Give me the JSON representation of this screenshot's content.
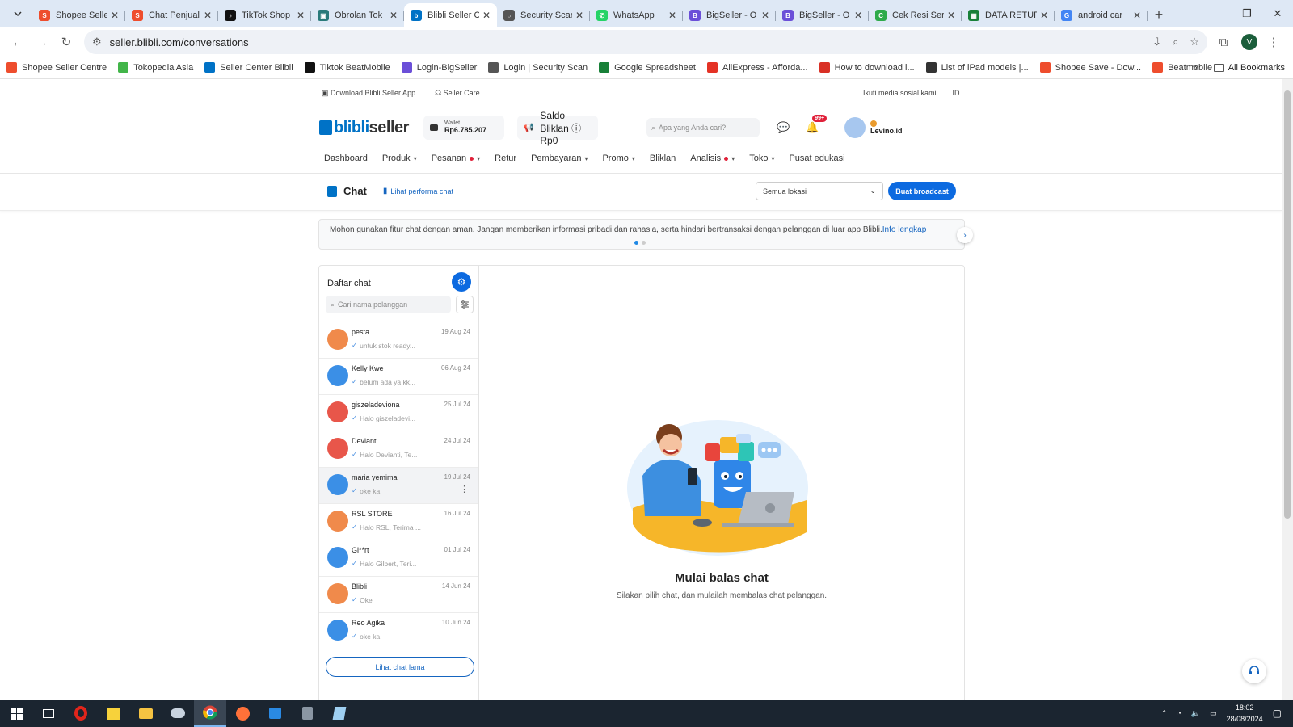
{
  "browser": {
    "tabs": [
      {
        "title": "Shopee Seller",
        "color": "#ee4d2d",
        "glyph": "S",
        "active": false
      },
      {
        "title": "Chat Penjual",
        "color": "#ee4d2d",
        "glyph": "S",
        "active": false
      },
      {
        "title": "TikTok Shop",
        "color": "#111111",
        "glyph": "♪",
        "active": false
      },
      {
        "title": "Obrolan Tok",
        "color": "#2a7a7a",
        "glyph": "▣",
        "active": false
      },
      {
        "title": "Blibli Seller C",
        "color": "#0072c6",
        "glyph": "b",
        "active": true
      },
      {
        "title": "Security Scan",
        "color": "#555555",
        "glyph": "○",
        "active": false
      },
      {
        "title": "WhatsApp",
        "color": "#25d366",
        "glyph": "✆",
        "active": false
      },
      {
        "title": "BigSeller - O",
        "color": "#6b4fd8",
        "glyph": "B",
        "active": false
      },
      {
        "title": "BigSeller - O",
        "color": "#6b4fd8",
        "glyph": "B",
        "active": false
      },
      {
        "title": "Cek Resi Ser",
        "color": "#2eaa4a",
        "glyph": "C",
        "active": false
      },
      {
        "title": "DATA RETUR",
        "color": "#188038",
        "glyph": "▦",
        "active": false
      },
      {
        "title": "android car",
        "color": "#4285f4",
        "glyph": "G",
        "active": false
      }
    ],
    "url": "seller.blibli.com/conversations",
    "profile_initial": "V",
    "bookmarks": [
      {
        "label": "Shopee Seller Centre",
        "color": "#ee4d2d"
      },
      {
        "label": "Tokopedia Asia",
        "color": "#42b549"
      },
      {
        "label": "Seller Center Blibli",
        "color": "#0072c6"
      },
      {
        "label": "Tiktok BeatMobile",
        "color": "#111111"
      },
      {
        "label": "Login-BigSeller",
        "color": "#6b4fd8"
      },
      {
        "label": "Login | Security Scan",
        "color": "#555555"
      },
      {
        "label": "Google Spreadsheet",
        "color": "#188038"
      },
      {
        "label": "AliExpress - Afforda...",
        "color": "#e43225"
      },
      {
        "label": "How to download i...",
        "color": "#d93025"
      },
      {
        "label": "List of iPad models |...",
        "color": "#333333"
      },
      {
        "label": "Shopee Save - Dow...",
        "color": "#ee4d2d"
      },
      {
        "label": "Beatmobile",
        "color": "#ee4d2d"
      }
    ],
    "all_bookmarks": "All Bookmarks"
  },
  "topbar": {
    "download_app": "Download Blibli Seller App",
    "seller_care": "Seller Care",
    "social": "Ikuti media sosial kami",
    "lang": "ID"
  },
  "header": {
    "logo_blibli": "blibli",
    "logo_seller": "seller",
    "wallet_label": "Wallet",
    "wallet_value": "Rp6.785.207",
    "saldo_label": "Saldo Bliklan",
    "saldo_value": "Rp0",
    "search_placeholder": "Apa yang Anda cari?",
    "notif_badge": "99+",
    "username": "Levino.id"
  },
  "nav": [
    {
      "label": "Dashboard",
      "chev": false,
      "dot": false
    },
    {
      "label": "Produk",
      "chev": true,
      "dot": false
    },
    {
      "label": "Pesanan",
      "chev": true,
      "dot": true
    },
    {
      "label": "Retur",
      "chev": false,
      "dot": false
    },
    {
      "label": "Pembayaran",
      "chev": true,
      "dot": false
    },
    {
      "label": "Promo",
      "chev": true,
      "dot": false
    },
    {
      "label": "Bliklan",
      "chev": false,
      "dot": false
    },
    {
      "label": "Analisis",
      "chev": true,
      "dot": true
    },
    {
      "label": "Toko",
      "chev": true,
      "dot": false
    },
    {
      "label": "Pusat edukasi",
      "chev": false,
      "dot": false
    }
  ],
  "chatbar": {
    "title": "Chat",
    "performance": "Lihat performa chat",
    "location": "Semua lokasi",
    "broadcast": "Buat broadcast"
  },
  "notice": {
    "text": "Mohon gunakan fitur chat dengan aman. Jangan memberikan informasi pribadi dan rahasia, serta hindari bertransaksi dengan pelanggan di luar app Blibli.",
    "link": "Info lengkap"
  },
  "chat_list": {
    "title": "Daftar chat",
    "search_placeholder": "Cari nama pelanggan",
    "items": [
      {
        "name": "pesta",
        "date": "19 Aug 24",
        "preview": "untuk stok ready...",
        "avatar": "#f08a4b",
        "selected": false
      },
      {
        "name": "Kelly Kwe",
        "date": "06 Aug 24",
        "preview": "belum ada ya kk...",
        "avatar": "#3b8fe6",
        "selected": false
      },
      {
        "name": "giszeladeviona",
        "date": "25 Jul 24",
        "preview": "Halo giszeladevi...",
        "avatar": "#e8564a",
        "selected": false
      },
      {
        "name": "Devianti",
        "date": "24 Jul 24",
        "preview": "Halo Devianti, Te...",
        "avatar": "#e8564a",
        "selected": false
      },
      {
        "name": "maria yemima",
        "date": "19 Jul 24",
        "preview": "oke ka",
        "avatar": "#3b8fe6",
        "selected": true
      },
      {
        "name": "RSL STORE",
        "date": "16 Jul 24",
        "preview": "Halo RSL, Terima ...",
        "avatar": "#f08a4b",
        "selected": false
      },
      {
        "name": "Gi**rt",
        "date": "01 Jul 24",
        "preview": "Halo Gilbert, Teri...",
        "avatar": "#3b8fe6",
        "selected": false
      },
      {
        "name": "Blibli",
        "date": "14 Jun 24",
        "preview": "Oke",
        "avatar": "#f08a4b",
        "selected": false
      },
      {
        "name": "Reo Agika",
        "date": "10 Jun 24",
        "preview": "oke ka",
        "avatar": "#3b8fe6",
        "selected": false
      }
    ],
    "old_chat": "Lihat chat lama"
  },
  "empty_state": {
    "title": "Mulai balas chat",
    "subtitle": "Silakan pilih chat, dan mulailah membalas chat pelanggan."
  },
  "taskbar": {
    "time": "18:02",
    "date": "28/08/2024"
  }
}
